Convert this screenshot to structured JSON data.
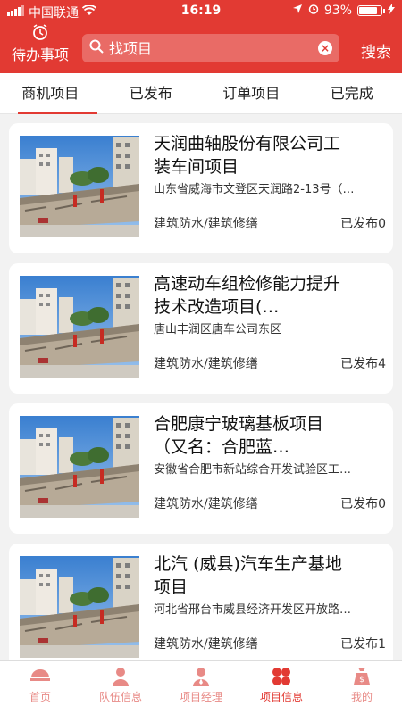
{
  "status": {
    "carrier": "中国联通",
    "time": "16:19",
    "battery": "93%"
  },
  "header": {
    "todo_label": "待办事项",
    "search_placeholder": "找项目",
    "search_button": "搜索"
  },
  "tabs": [
    {
      "label": "商机项目",
      "active": true
    },
    {
      "label": "已发布"
    },
    {
      "label": "订单项目"
    },
    {
      "label": "已完成"
    }
  ],
  "projects": [
    {
      "title": "天润曲轴股份有限公司工装车间项目",
      "address": "山东省威海市文登区天润路2-13号（…",
      "category": "建筑防水/建筑修缮",
      "published": "已发布0"
    },
    {
      "title": "高速动车组检修能力提升技术改造项目(…",
      "address": "唐山丰润区唐车公司东区",
      "category": "建筑防水/建筑修缮",
      "published": "已发布4"
    },
    {
      "title": "合肥康宁玻璃基板项目（又名：合肥蓝…",
      "address": "安徽省合肥市新站综合开发试验区工…",
      "category": "建筑防水/建筑修缮",
      "published": "已发布0"
    },
    {
      "title": "北汽 (威县)汽车生产基地项目",
      "address": "河北省邢台市威县经济开发区开放路…",
      "category": "建筑防水/建筑修缮",
      "published": "已发布1"
    }
  ],
  "bottom_nav": [
    {
      "label": "首页",
      "icon": "home-icon"
    },
    {
      "label": "队伍信息",
      "icon": "team-icon"
    },
    {
      "label": "项目经理",
      "icon": "manager-icon"
    },
    {
      "label": "项目信息",
      "icon": "project-info-icon",
      "active": true
    },
    {
      "label": "我的",
      "icon": "wallet-icon"
    }
  ]
}
